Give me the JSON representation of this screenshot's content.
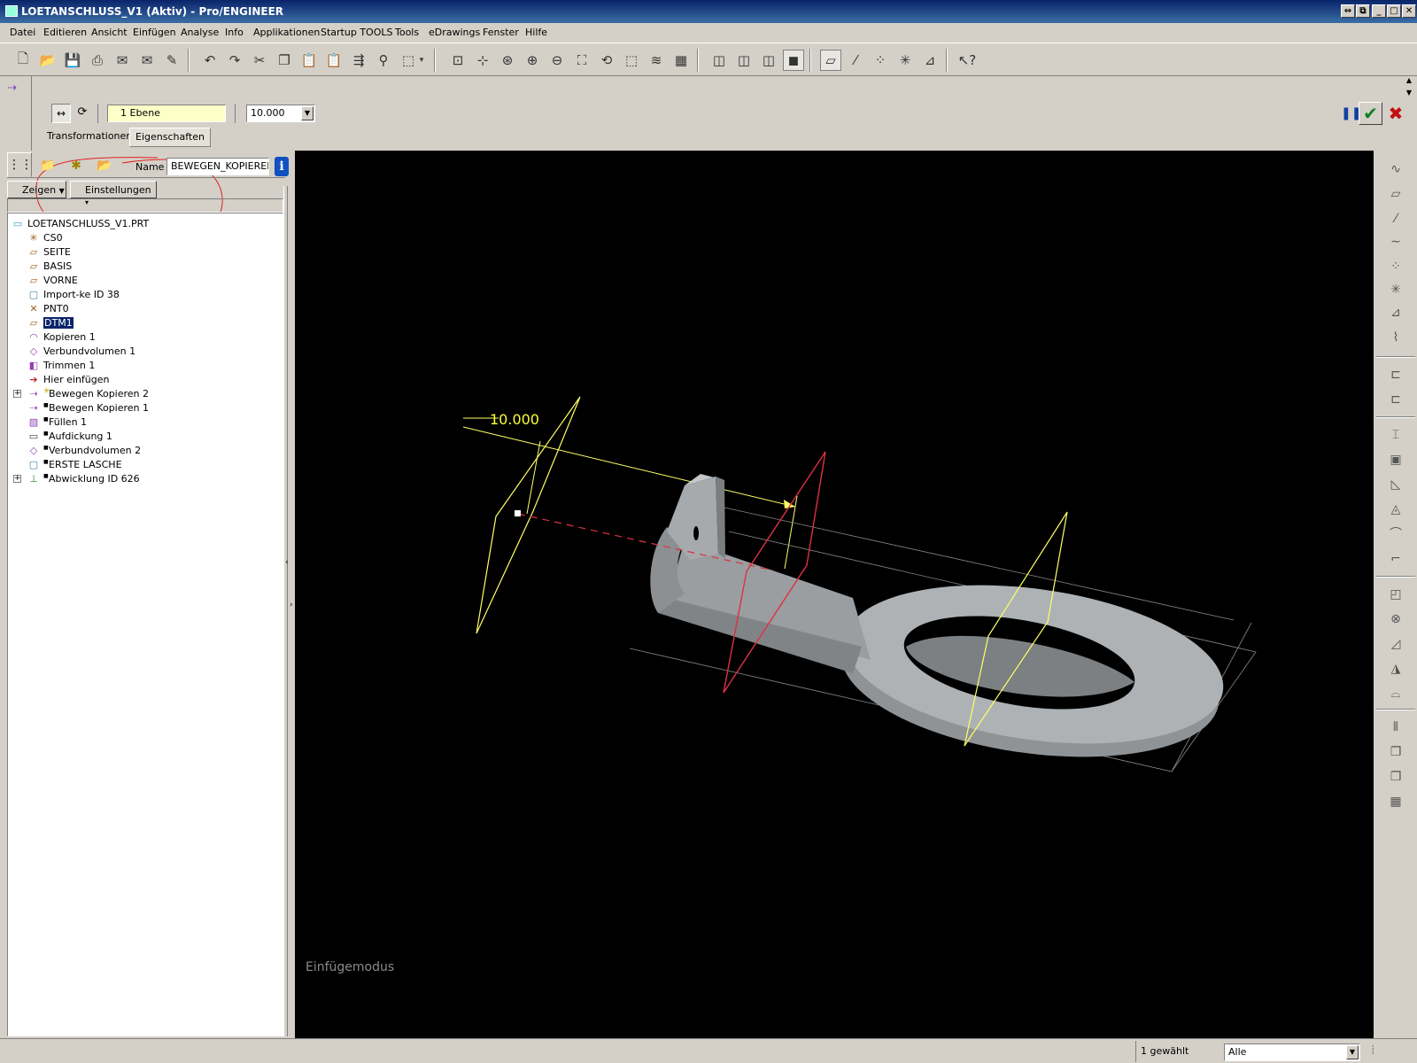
{
  "window": {
    "title": "LOETANSCHLUSS_V1 (Aktiv) - Pro/ENGINEER",
    "controls": [
      "⇔",
      "⧉",
      "_",
      "□",
      "✕"
    ]
  },
  "menu": [
    "Datei",
    "Editieren",
    "Ansicht",
    "Einfügen",
    "Analyse",
    "Info",
    "Applikationen",
    "Startup TOOLS",
    "Tools",
    "eDrawings",
    "Fenster",
    "Hilfe"
  ],
  "dashboard": {
    "reference_field": "1 Ebene",
    "distance_value": "10.000",
    "tabs": [
      "Transformationen",
      "Eigenschaften"
    ],
    "name_label": "Name",
    "name_value": "BEWEGEN_KOPIEREI",
    "info_icon_text": "i"
  },
  "left_panel": {
    "show_button": "Zeigen",
    "settings_button": "Einstellungen"
  },
  "model_tree": [
    {
      "label": "LOETANSCHLUSS_V1.PRT",
      "icon": "part-icon",
      "glyph": "▭",
      "indent": 0,
      "expand": false,
      "marker": ""
    },
    {
      "label": "CS0",
      "icon": "coordinate-system-icon",
      "glyph": "✳",
      "indent": 1,
      "expand": false,
      "marker": ""
    },
    {
      "label": "SEITE",
      "icon": "datum-plane-icon",
      "glyph": "▱",
      "indent": 1,
      "expand": false,
      "marker": ""
    },
    {
      "label": "BASIS",
      "icon": "datum-plane-icon",
      "glyph": "▱",
      "indent": 1,
      "expand": false,
      "marker": ""
    },
    {
      "label": "VORNE",
      "icon": "datum-plane-icon",
      "glyph": "▱",
      "indent": 1,
      "expand": false,
      "marker": ""
    },
    {
      "label": "Import-ke ID 38",
      "icon": "import-feature-icon",
      "glyph": "▢",
      "indent": 1,
      "expand": false,
      "marker": ""
    },
    {
      "label": "PNT0",
      "icon": "datum-point-icon",
      "glyph": "✕",
      "indent": 1,
      "expand": false,
      "marker": ""
    },
    {
      "label": "DTM1",
      "icon": "datum-plane-icon",
      "glyph": "▱",
      "indent": 1,
      "expand": false,
      "marker": "",
      "selected": true
    },
    {
      "label": "Kopieren 1",
      "icon": "copy-feature-icon",
      "glyph": "◠",
      "indent": 1,
      "expand": false,
      "marker": ""
    },
    {
      "label": "Verbundvolumen 1",
      "icon": "merge-volume-icon",
      "glyph": "◇",
      "indent": 1,
      "expand": false,
      "marker": ""
    },
    {
      "label": "Trimmen 1",
      "icon": "trim-feature-icon",
      "glyph": "◧",
      "indent": 1,
      "expand": false,
      "marker": ""
    },
    {
      "label": "Hier einfügen",
      "icon": "insert-here-arrow-icon",
      "glyph": "➔",
      "indent": 1,
      "expand": false,
      "marker": ""
    },
    {
      "label": "Bewegen Kopieren 2",
      "icon": "move-copy-icon",
      "glyph": "⇢",
      "indent": 1,
      "expand": true,
      "marker": "✳"
    },
    {
      "label": "Bewegen Kopieren 1",
      "icon": "move-copy-icon",
      "glyph": "⇢",
      "indent": 1,
      "expand": false,
      "marker": "■"
    },
    {
      "label": "Füllen 1",
      "icon": "fill-feature-icon",
      "glyph": "▨",
      "indent": 1,
      "expand": false,
      "marker": "■"
    },
    {
      "label": "Aufdickung 1",
      "icon": "thicken-feature-icon",
      "glyph": "▭",
      "indent": 1,
      "expand": false,
      "marker": "■"
    },
    {
      "label": "Verbundvolumen 2",
      "icon": "merge-volume-icon",
      "glyph": "◇",
      "indent": 1,
      "expand": false,
      "marker": "■"
    },
    {
      "label": "ERSTE LASCHE",
      "icon": "sheetmetal-wall-icon",
      "glyph": "▢",
      "indent": 1,
      "expand": false,
      "marker": "■"
    },
    {
      "label": "Abwicklung ID 626",
      "icon": "flatten-feature-icon",
      "glyph": "⊥",
      "indent": 1,
      "expand": true,
      "marker": "■"
    }
  ],
  "viewport": {
    "dimension_label": "10.000",
    "mode_text": "Einfügemodus"
  },
  "status": {
    "selected_count": "1 gewählt",
    "filter_value": "Alle"
  },
  "colors": {
    "titlebar": "#0a246a",
    "datum_plane": "#ffff66",
    "selected_plane": "#e03040",
    "part_shading": "#a0a4a8",
    "dimension_text": "#ffff33"
  }
}
